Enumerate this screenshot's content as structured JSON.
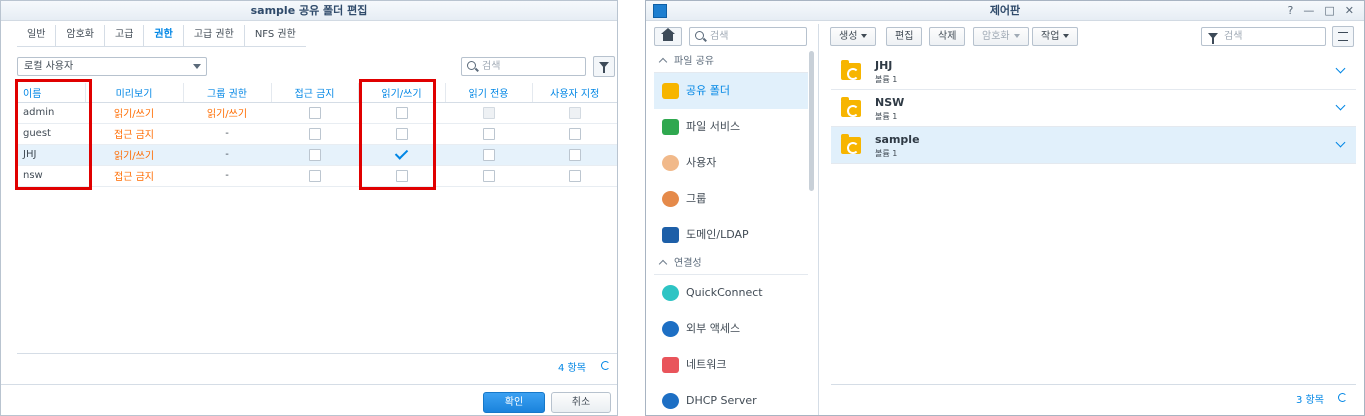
{
  "left_window": {
    "title": "sample 공유 폴더 편집",
    "tabs": [
      {
        "label": "일반"
      },
      {
        "label": "암호화"
      },
      {
        "label": "고급"
      },
      {
        "label": "권한",
        "active": true
      },
      {
        "label": "고급 권한"
      },
      {
        "label": "NFS 권한"
      }
    ],
    "user_type_select": "로컬 사용자",
    "search_placeholder": "검색",
    "columns": [
      "이름",
      "미리보기",
      "그룹 권한",
      "접근 금지",
      "읽기/쓰기",
      "읽기 전용",
      "사용자 지정"
    ],
    "rows": [
      {
        "name": "admin",
        "preview": "읽기/쓰기",
        "group": "읽기/쓰기",
        "deny": false,
        "rw": false,
        "ro": false,
        "custom": false,
        "disabled": true
      },
      {
        "name": "guest",
        "preview": "접근 금지",
        "group": "-",
        "deny": false,
        "rw": false,
        "ro": false,
        "custom": false
      },
      {
        "name": "JHJ",
        "preview": "읽기/쓰기",
        "group": "-",
        "deny": false,
        "rw": true,
        "ro": false,
        "custom": false,
        "selected": true
      },
      {
        "name": "nsw",
        "preview": "접근 금지",
        "group": "-",
        "deny": false,
        "rw": false,
        "ro": false,
        "custom": false
      }
    ],
    "item_count": "4 항목",
    "ok_label": "확인",
    "cancel_label": "취소",
    "highlight_color": "#e00000",
    "accent_color": "#0086e5",
    "warning_color": "#ff6c00"
  },
  "right_window": {
    "title": "제어판",
    "controls": [
      "?",
      "—",
      "□",
      "✕"
    ],
    "search_placeholder": "검색",
    "sidebar": {
      "sections": [
        {
          "label": "파일 공유",
          "items": [
            {
              "label": "공유 폴더",
              "icon": "shared-folder-icon",
              "active": true
            },
            {
              "label": "파일 서비스",
              "icon": "file-services-icon"
            },
            {
              "label": "사용자",
              "icon": "user-icon"
            },
            {
              "label": "그룹",
              "icon": "group-icon"
            },
            {
              "label": "도메인/LDAP",
              "icon": "domain-ldap-icon"
            }
          ]
        },
        {
          "label": "연결성",
          "items": [
            {
              "label": "QuickConnect",
              "icon": "quickconnect-icon"
            },
            {
              "label": "외부 액세스",
              "icon": "external-access-icon"
            },
            {
              "label": "네트워크",
              "icon": "network-icon"
            },
            {
              "label": "DHCP Server",
              "icon": "dhcp-server-icon"
            }
          ]
        }
      ]
    },
    "toolbar": {
      "create": "생성",
      "edit": "편집",
      "delete": "삭제",
      "encrypt": "암호화",
      "action": "작업",
      "search_placeholder": "검색"
    },
    "folders": [
      {
        "name": "JHJ",
        "sub": "볼륨 1"
      },
      {
        "name": "NSW",
        "sub": "볼륨 1"
      },
      {
        "name": "sample",
        "sub": "볼륨 1",
        "selected": true
      }
    ],
    "item_count": "3 항목"
  }
}
